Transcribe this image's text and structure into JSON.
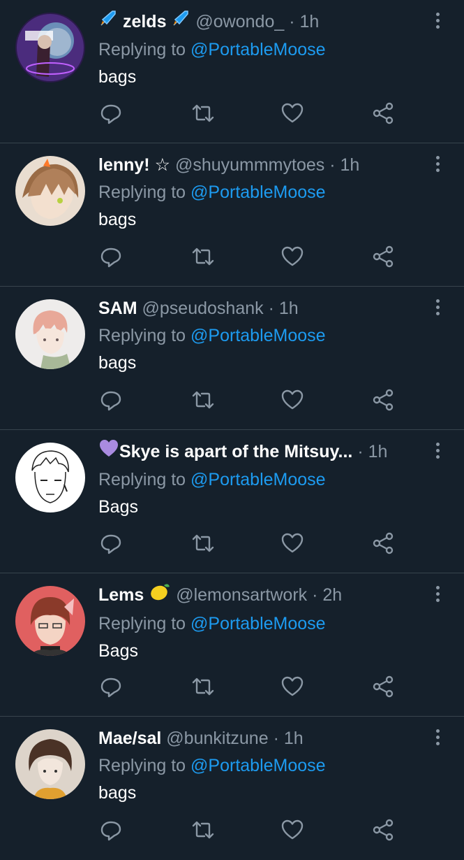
{
  "tweets": [
    {
      "name_prefix": "",
      "name": "zelds",
      "name_suffix": "",
      "handle": "@owondo_",
      "time": "· 1h",
      "reply_label": "Replying to",
      "mention": "@PortableMoose",
      "text": "bags",
      "avatar_color": "#5a3a8a",
      "emoji": "rocket"
    },
    {
      "name_prefix": "",
      "name": "lenny! ☆",
      "name_suffix": "",
      "handle": "@shuyummmytoes",
      "time": "· 1h",
      "reply_label": "Replying to",
      "mention": "@PortableMoose",
      "text": "bags",
      "avatar_color": "#c9a98a",
      "emoji": ""
    },
    {
      "name_prefix": "",
      "name": "SAM",
      "name_suffix": "",
      "handle": "@pseudoshank",
      "time": "· 1h",
      "reply_label": "Replying to",
      "mention": "@PortableMoose",
      "text": "bags",
      "avatar_color": "#e8e6e3",
      "emoji": ""
    },
    {
      "name_prefix": "",
      "name": "Skye is apart of the Mitsuy...",
      "name_suffix": "",
      "handle": "",
      "time": "· 1h",
      "reply_label": "Replying to",
      "mention": "@PortableMoose",
      "text": "Bags",
      "avatar_color": "#f4f4f4",
      "emoji": "purple-heart"
    },
    {
      "name_prefix": "",
      "name": "Lems",
      "name_suffix": "",
      "handle": "@lemonsartwork",
      "time": "· 2h",
      "reply_label": "Replying to",
      "mention": "@PortableMoose",
      "text": "Bags",
      "avatar_color": "#e06060",
      "emoji": "lemon"
    },
    {
      "name_prefix": "",
      "name": "Mae/sal",
      "name_suffix": "",
      "handle": "@bunkitzune",
      "time": "· 1h",
      "reply_label": "Replying to",
      "mention": "@PortableMoose",
      "text": "bags",
      "avatar_color": "#d8cec4",
      "emoji": ""
    }
  ],
  "icons": {
    "reply": "reply-icon",
    "retweet": "retweet-icon",
    "like": "heart-icon",
    "share": "share-icon",
    "more": "more-icon"
  },
  "colors": {
    "background": "#15202b",
    "muted": "#8b98a5",
    "link": "#1d9bf0",
    "divider": "#38444d"
  }
}
